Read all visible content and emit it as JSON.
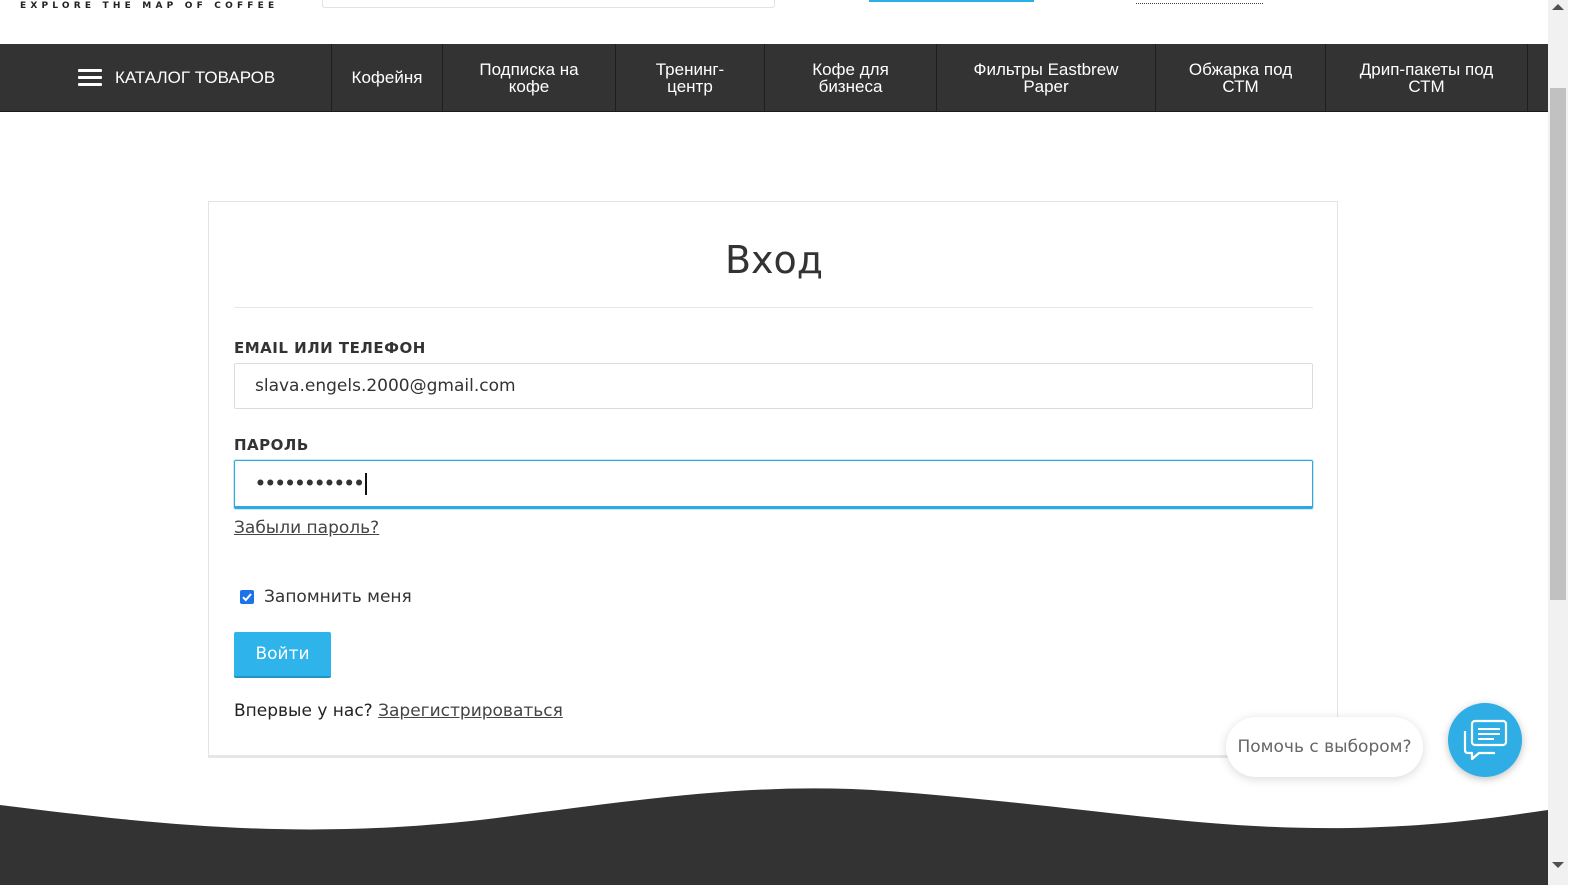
{
  "header": {
    "tagline": "EXPLORE THE MAP OF COFFEE"
  },
  "nav": {
    "catalog_label": "КАТАЛОГ ТОВАРОВ",
    "items": [
      {
        "label": "Кофейня"
      },
      {
        "label": "Подписка на кофе"
      },
      {
        "label": "Тренинг-центр"
      },
      {
        "label": "Кофе для бизнеса"
      },
      {
        "label": "Фильтры Eastbrew Paper"
      },
      {
        "label": "Обжарка под СТМ"
      },
      {
        "label": "Дрип-пакеты под СТМ"
      }
    ]
  },
  "login": {
    "title": "Вход",
    "email_label": "EMAIL ИЛИ ТЕЛЕФОН",
    "email_value": "slava.engels.2000@gmail.com",
    "password_label": "ПАРОЛЬ",
    "password_mask": "•••••••••••",
    "forgot_link": "Забыли пароль?",
    "remember_label": "Запомнить меня",
    "remember_checked": true,
    "submit_label": "Войти",
    "register_prompt": "Впервые у нас?",
    "register_link": "Зарегистрироваться"
  },
  "chat": {
    "prompt": "Помочь с выбором?",
    "icon": "chat-icon"
  },
  "colors": {
    "accent": "#2eb3ea",
    "nav_bg": "#333333",
    "footer_bg": "#333333"
  }
}
